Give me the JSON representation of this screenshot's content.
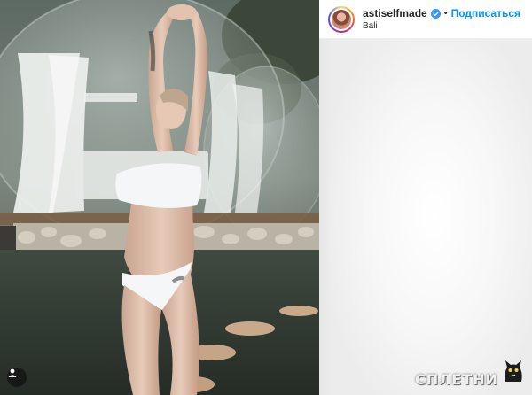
{
  "post": {
    "username": "astiselfmade",
    "verified": true,
    "separator": "•",
    "follow_label": "Подписаться",
    "location": "Bali"
  },
  "watermark": {
    "text": "СПЛЕТНИ"
  },
  "colors": {
    "follow": "#0095f6",
    "verified_badge": "#3897f0",
    "panel_bg": "#fafafa"
  },
  "icons": {
    "verified": "verified-badge-icon",
    "user_tag": "user-tag-icon",
    "watermark_logo": "cat-logo-icon"
  }
}
